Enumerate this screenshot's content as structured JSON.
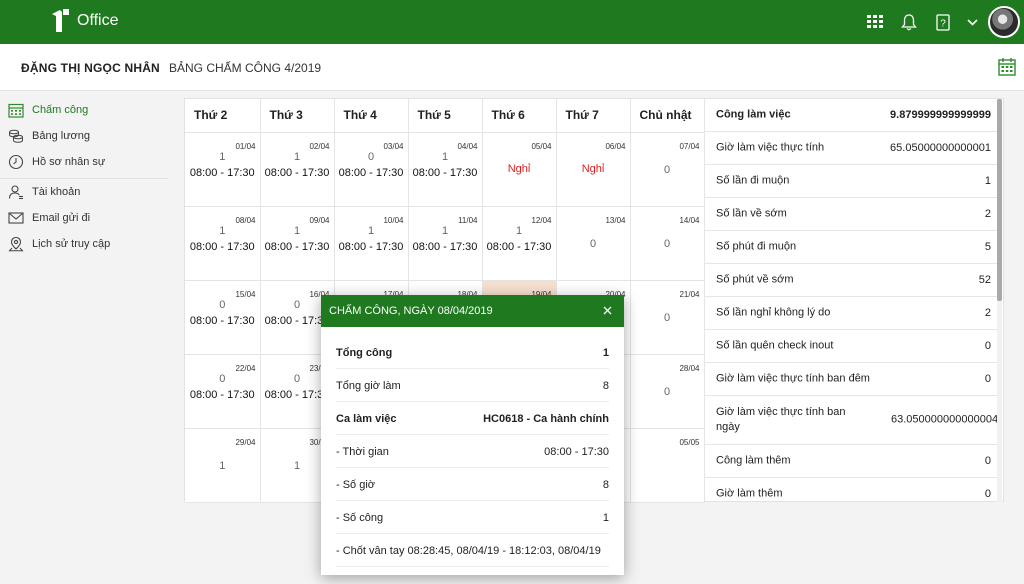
{
  "app": {
    "name": "Office"
  },
  "header": {
    "employee": "ĐẶNG THỊ NGỌC NHÂN",
    "title": "BẢNG CHẤM CÔNG 4/2019"
  },
  "sidebar": {
    "items": [
      {
        "label": "Chấm công",
        "icon": "calendar-icon",
        "active": true
      },
      {
        "label": "Bảng lương",
        "icon": "coins-icon"
      },
      {
        "label": "Hồ sơ nhân sự",
        "icon": "clock-icon"
      },
      {
        "label": "Tài khoản",
        "icon": "user-icon"
      },
      {
        "label": "Email gửi đi",
        "icon": "mail-icon"
      },
      {
        "label": "Lịch sử truy cập",
        "icon": "location-icon"
      }
    ]
  },
  "calendar": {
    "days": [
      "Thứ 2",
      "Thứ 3",
      "Thứ 4",
      "Thứ 5",
      "Thứ 6",
      "Thứ 7",
      "Chủ nhật"
    ],
    "weeks": [
      [
        {
          "date": "01/04",
          "work": "1",
          "hours": "08:00 - 17:30"
        },
        {
          "date": "02/04",
          "work": "1",
          "hours": "08:00 - 17:30"
        },
        {
          "date": "03/04",
          "work": "0",
          "hours": "08:00 - 17:30"
        },
        {
          "date": "04/04",
          "work": "1",
          "hours": "08:00 - 17:30"
        },
        {
          "date": "05/04",
          "off": "Nghỉ"
        },
        {
          "date": "06/04",
          "off": "Nghỉ"
        },
        {
          "date": "07/04",
          "work": "0"
        }
      ],
      [
        {
          "date": "08/04",
          "work": "1",
          "hours": "08:00 - 17:30"
        },
        {
          "date": "09/04",
          "work": "1",
          "hours": "08:00 - 17:30"
        },
        {
          "date": "10/04",
          "work": "1",
          "hours": "08:00 - 17:30"
        },
        {
          "date": "11/04",
          "work": "1",
          "hours": "08:00 - 17:30"
        },
        {
          "date": "12/04",
          "work": "1",
          "hours": "08:00 - 17:30"
        },
        {
          "date": "13/04",
          "work": "0"
        },
        {
          "date": "14/04",
          "work": "0"
        }
      ],
      [
        {
          "date": "15/04",
          "work": "0",
          "hours": "08:00 - 17:30"
        },
        {
          "date": "16/04",
          "work": "0",
          "hours": "08:00 - 17:30"
        },
        {
          "date": "17/04"
        },
        {
          "date": "18/04"
        },
        {
          "date": "19/04",
          "highlight": true
        },
        {
          "date": "20/04"
        },
        {
          "date": "21/04",
          "work": "0"
        }
      ],
      [
        {
          "date": "22/04",
          "work": "0",
          "hours": "08:00 - 17:30"
        },
        {
          "date": "23/04",
          "work": "0",
          "hours": "08:00 - 17:30"
        },
        {},
        {},
        {},
        {},
        {
          "date": "28/04",
          "work": "0"
        }
      ],
      [
        {
          "date": "29/04",
          "work": "1"
        },
        {
          "date": "30/04",
          "work": "1"
        },
        {},
        {},
        {},
        {},
        {
          "date": "05/05"
        }
      ]
    ]
  },
  "summary": {
    "rows": [
      {
        "label": "Công làm việc",
        "value": "9.879999999999999",
        "bold": true
      },
      {
        "label": "Giờ làm việc thực tính",
        "value": "65.05000000000001"
      },
      {
        "label": "Số lần đi muộn",
        "value": "1"
      },
      {
        "label": "Số lần về sớm",
        "value": "2"
      },
      {
        "label": "Số phút đi muộn",
        "value": "5"
      },
      {
        "label": "Số phút về sớm",
        "value": "52"
      },
      {
        "label": "Số lần nghỉ không lý do",
        "value": "2"
      },
      {
        "label": "Số lần quên check inout",
        "value": "0"
      },
      {
        "label": "Giờ làm việc thực tính ban đêm",
        "value": "0"
      },
      {
        "label": "Giờ làm việc thực tính ban ngày",
        "value": "63.050000000000004",
        "wrap": true
      },
      {
        "label": "Công làm thêm",
        "value": "0"
      },
      {
        "label": "Giờ làm thêm",
        "value": "0"
      }
    ]
  },
  "modal": {
    "title": "CHẤM CÔNG, NGÀY 08/04/2019",
    "rows": [
      {
        "label": "Tổng công",
        "value": "1",
        "bold": true
      },
      {
        "label": "Tổng giờ làm",
        "value": "8"
      },
      {
        "label": "Ca làm việc",
        "value": "HC0618 - Ca hành chính",
        "bold": true
      },
      {
        "label": "- Thời gian",
        "value": "08:00 - 17:30"
      },
      {
        "label": "- Số giờ",
        "value": "8"
      },
      {
        "label": "- Số công",
        "value": "1"
      },
      {
        "label": "- Chốt vân tay 08:28:45, 08/04/19 - 18:12:03, 08/04/19",
        "value": ""
      }
    ]
  },
  "colors": {
    "primary": "#1f7a1f",
    "off": "#e02020",
    "highlight": "#f8e0cf"
  }
}
